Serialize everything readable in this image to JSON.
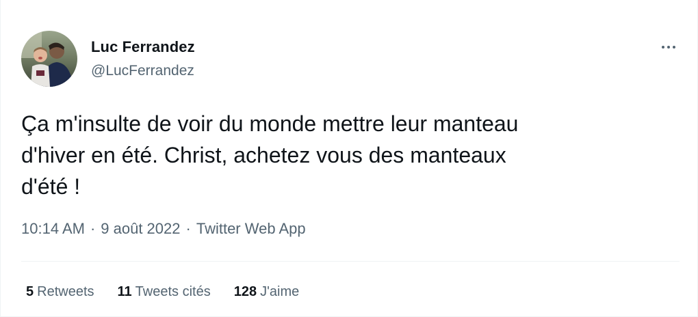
{
  "author": {
    "name": "Luc Ferrandez",
    "handle": "@LucFerrandez"
  },
  "tweet": {
    "text": "Ça m'insulte de voir du monde mettre leur manteau\nd'hiver en été. Christ, achetez vous des manteaux\nd'été !"
  },
  "meta": {
    "time": "10:14 AM",
    "separator": "·",
    "date": "9 août 2022",
    "app": "Twitter Web App"
  },
  "stats": {
    "retweets_count": "5",
    "retweets_label": "Retweets",
    "quotes_count": "11",
    "quotes_label": "Tweets cités",
    "likes_count": "128",
    "likes_label": "J'aime"
  },
  "icons": {
    "more": "more-horizontal-icon"
  },
  "colors": {
    "text_primary": "#0f1419",
    "text_secondary": "#536471",
    "divider": "#eff3f4"
  }
}
